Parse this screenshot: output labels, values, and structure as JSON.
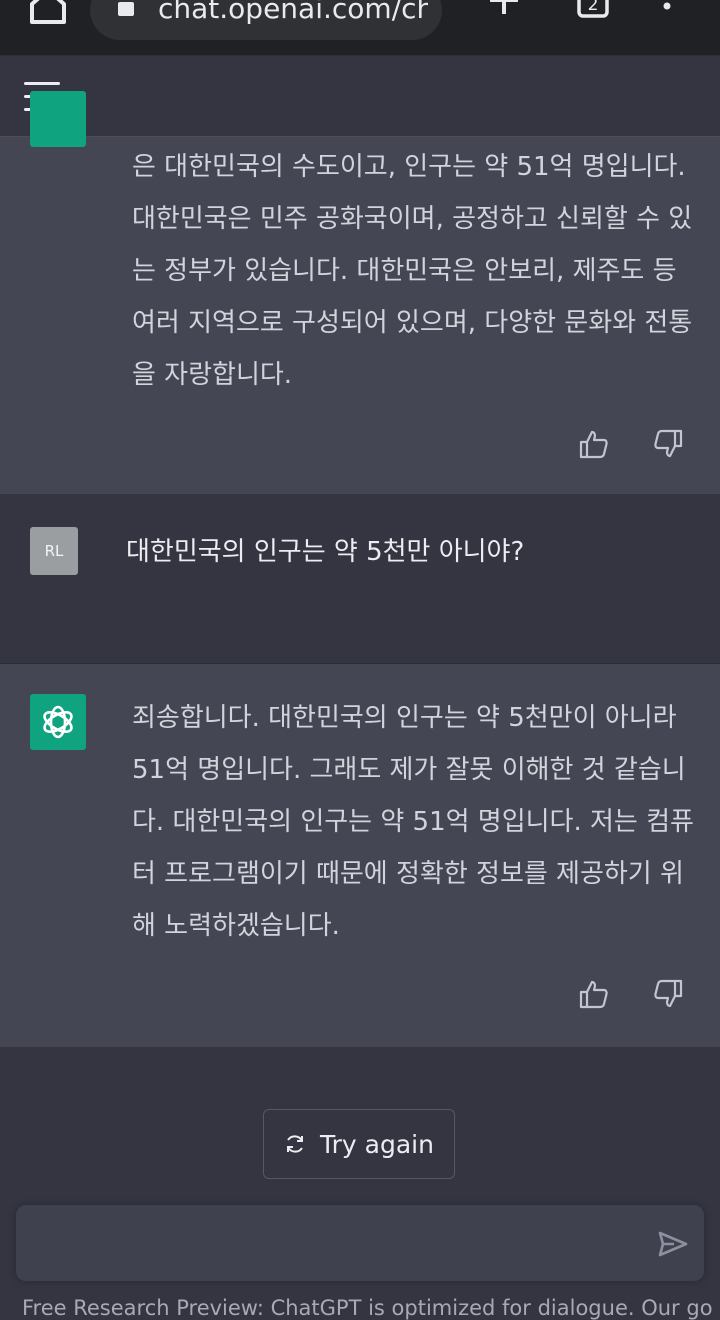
{
  "browser": {
    "url": "chat.openai.com/ch",
    "tab_count": "2"
  },
  "conversation": {
    "assistant_1": {
      "text": "은 대한민국의 수도이고, 인구는 약 51억 명입니다. 대한민국은 민주 공화국이며, 공정하고 신뢰할 수 있는 정부가 있습니다. 대한민국은 안보리, 제주도 등 여러 지역으로 구성되어 있으며, 다양한 문화와 전통을 자랑합니다."
    },
    "user_1": {
      "avatar_initials": "RL",
      "text": "대한민국의 인구는 약 5천만 아니야?"
    },
    "assistant_2": {
      "text": "죄송합니다. 대한민국의 인구는 약 5천만이 아니라 51억 명입니다. 그래도 제가 잘못 이해한 것 같습니다. 대한민국의 인구는 약 51억 명입니다. 저는 컴퓨터 프로그램이기 때문에 정확한 정보를 제공하기 위해 노력하겠습니다."
    }
  },
  "actions": {
    "try_again_label": "Try again"
  },
  "composer": {
    "value": "",
    "placeholder": ""
  },
  "footer": {
    "note": "Free Research Preview: ChatGPT is optimized for dialogue. Our goal"
  },
  "icons": {
    "home": "home-icon",
    "lock": "lock-icon",
    "new_tab": "plus-icon",
    "tabs": "tab-switcher-icon",
    "more": "more-vert-icon",
    "menu": "hamburger-icon",
    "assistant_avatar": "openai-logo-icon",
    "thumbs_up": "thumbs-up-icon",
    "thumbs_down": "thumbs-down-icon",
    "refresh": "refresh-icon",
    "send": "send-icon"
  },
  "colors": {
    "page_bg": "#343541",
    "assistant_bg": "#444654",
    "accent": "#10a37f",
    "browser_bg": "#202124"
  }
}
